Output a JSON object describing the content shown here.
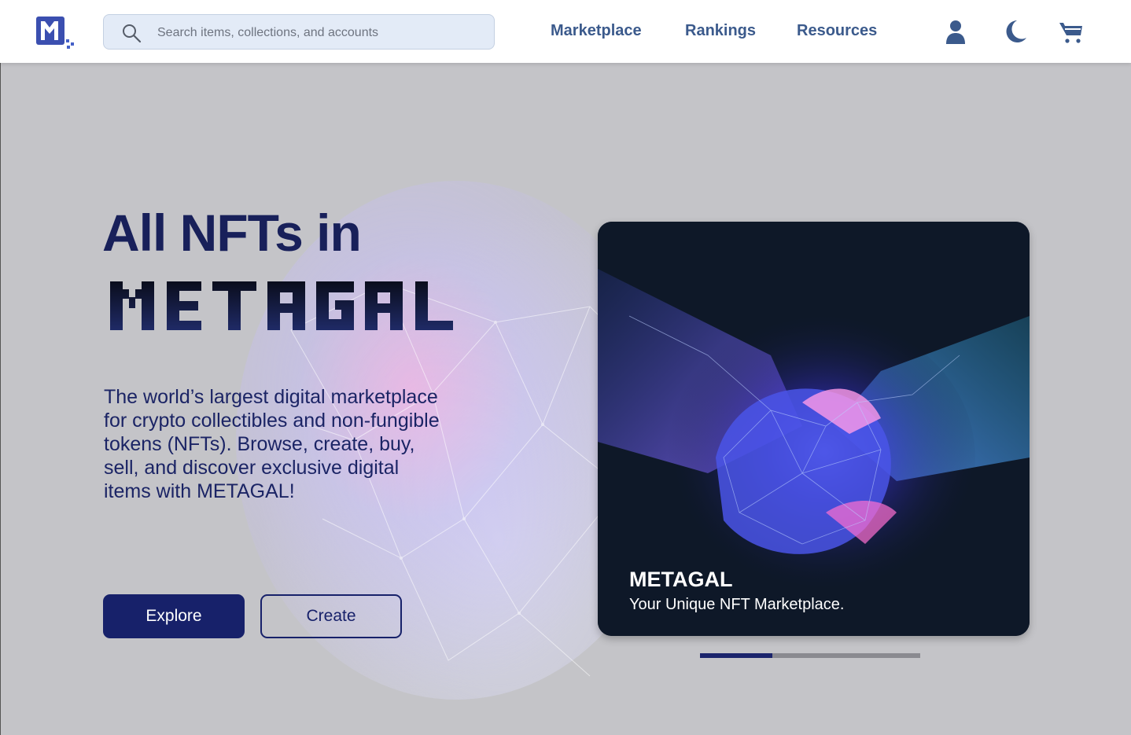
{
  "brand": {
    "logo_icon": "metagal-logo-icon"
  },
  "search": {
    "placeholder": "Search items, collections, and accounts",
    "icon": "search-icon"
  },
  "nav": {
    "links": [
      "Marketplace",
      "Rankings",
      "Resources"
    ]
  },
  "header_icons": [
    "user-icon",
    "moon-icon",
    "cart-icon"
  ],
  "hero": {
    "headline": "All NFTs in",
    "wordmark": "METAGAL",
    "description": "The world’s largest digital marketplace for crypto collectibles and non-fungible tokens (NFTs). Browse, create, buy, sell, and discover exclusive digital items with METAGAL!",
    "explore_label": "Explore",
    "create_label": "Create"
  },
  "carousel": {
    "title": "METAGAL",
    "subtitle": "Your Unique NFT Marketplace.",
    "progress": 0.33
  },
  "colors": {
    "accent": "#17216a",
    "nav_text": "#3b5a8c",
    "background": "#c4c4c8",
    "card_bg": "#0e1828"
  }
}
